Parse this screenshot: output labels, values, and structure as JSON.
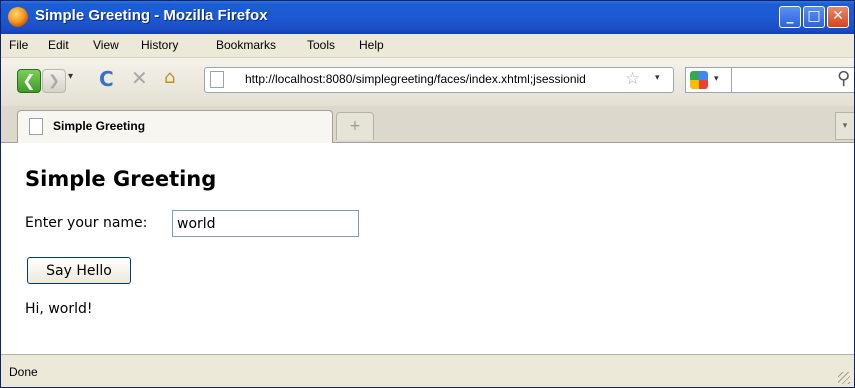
{
  "window": {
    "title": "Simple Greeting - Mozilla Firefox",
    "min_label": "_",
    "max_label": "□",
    "close_label": "✕"
  },
  "menubar": {
    "items": [
      "File",
      "Edit",
      "View",
      "History",
      "Bookmarks",
      "Tools",
      "Help"
    ]
  },
  "navbar": {
    "back_glyph": "❮",
    "forward_glyph": "❯",
    "dropdown_glyph": "▾",
    "reload_glyph": "C",
    "stop_glyph": "✕",
    "home_glyph": "⌂",
    "url": "http://localhost:8080/simplegreeting/faces/index.xhtml;jsessionid",
    "star_glyph": "☆",
    "search_glyph": "⚲",
    "search_value": ""
  },
  "tabs": {
    "active_label": "Simple Greeting",
    "newtab_glyph": "+",
    "list_glyph": "▾"
  },
  "page": {
    "title": "Simple Greeting",
    "name_label": "Enter your name:",
    "name_value": "world",
    "button_label": "Say Hello",
    "greeting": "Hi, world!"
  },
  "status": {
    "text": "Done"
  },
  "colors": {
    "titlebar": "#1d59d1",
    "chrome": "#ece9d8",
    "back_button": "#3e9b2a",
    "reload_icon": "#3b6fc9"
  }
}
